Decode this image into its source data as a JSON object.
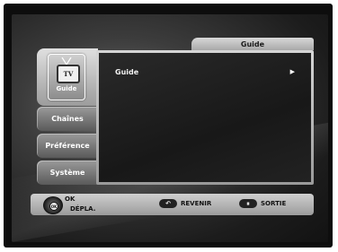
{
  "title": "Guide",
  "sidebar": {
    "items": [
      {
        "label": "Guide",
        "icon": "tv-icon",
        "active": true
      },
      {
        "label": "Chaînes"
      },
      {
        "label": "Préférence"
      },
      {
        "label": "Système"
      }
    ]
  },
  "main": {
    "items": [
      {
        "label": "Guide",
        "arrow": "▶"
      }
    ]
  },
  "tv_icon_text": "TV",
  "footer": {
    "ok_label": "OK",
    "nav_label": "DÉPLA.",
    "back_label": "REVENIR",
    "exit_label": "SORTIE",
    "back_icon": "↶",
    "exit_icon": "⏸"
  },
  "colors": {
    "panel_light": "#d6d6d6",
    "panel_dark": "#1c1c1c",
    "text_light": "#f2f2f2"
  }
}
